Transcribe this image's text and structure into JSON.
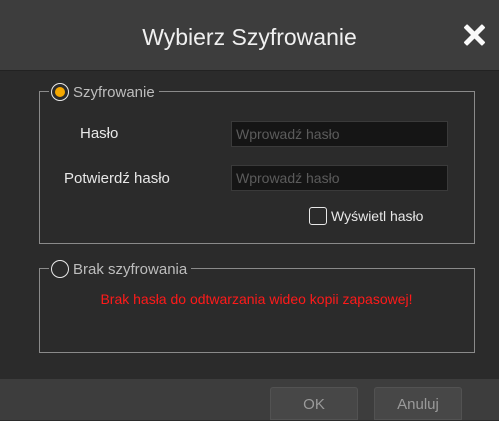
{
  "dialog": {
    "title": "Wybierz Szyfrowanie",
    "close_icon": "close-icon"
  },
  "encryption": {
    "label": "Szyfrowanie",
    "selected": true,
    "password_label": "Hasło",
    "password_placeholder": "Wprowadź hasło",
    "confirm_label": "Potwierdź hasło",
    "confirm_placeholder": "Wprowadź hasło",
    "show_password_label": "Wyświetl hasło",
    "show_password_checked": false
  },
  "no_encryption": {
    "label": "Brak szyfrowania",
    "selected": false,
    "warning": "Brak hasła do odtwarzania wideo kopii zapasowej!"
  },
  "footer": {
    "ok_label": "OK",
    "cancel_label": "Anuluj"
  },
  "colors": {
    "accent": "#f5a800",
    "warning": "#ff1a1a",
    "background": "#2b2b2b",
    "header": "#3d3d3d"
  }
}
